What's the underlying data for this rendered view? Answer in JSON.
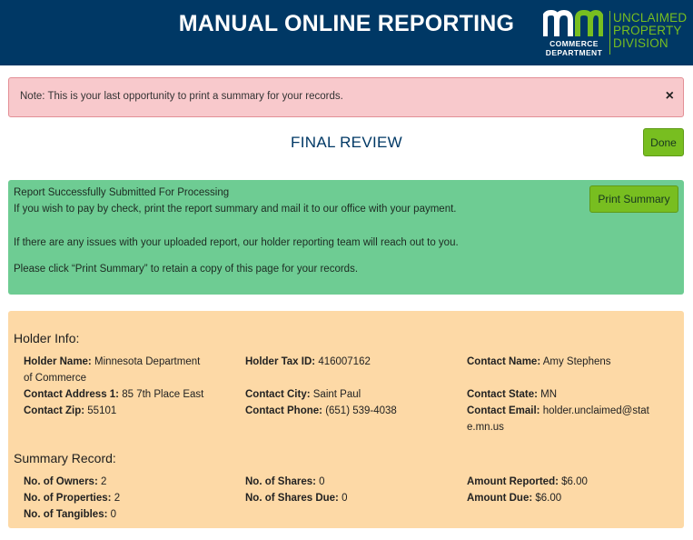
{
  "header": {
    "title": "MANUAL ONLINE REPORTING",
    "logo_top": "COMMERCE",
    "logo_bottom": "DEPARTMENT",
    "division_line1": "UNCLAIMED",
    "division_line2": "PROPERTY",
    "division_line3": "DIVISION",
    "colors": {
      "navy": "#003865",
      "green": "#78be20"
    }
  },
  "alert": {
    "text": "Note: This is your last opportunity to print a summary for your records.",
    "close_label": "×"
  },
  "page": {
    "title": "FINAL REVIEW",
    "done_label": "Done"
  },
  "success": {
    "heading": "Report Successfully Submitted For Processing",
    "line1": "If you wish to pay by check, print the report summary and mail it to our office with your payment.",
    "line2": "If there are any issues with your uploaded report, our holder reporting team will reach out to you.",
    "line3": "Please click “Print Summary” to retain a copy of this page for your records.",
    "print_label": "Print Summary"
  },
  "holder_info": {
    "title": "Holder Info:",
    "holder_name_label": "Holder Name:",
    "holder_name_value_a": "Minnesota Department",
    "holder_name_value_b": "of Commerce",
    "tax_id_label": "Holder Tax ID:",
    "tax_id_value": "416007162",
    "contact_name_label": "Contact Name:",
    "contact_name_value": "Amy Stephens",
    "address_label": "Contact Address 1:",
    "address_value": "85 7th Place East",
    "city_label": "Contact City:",
    "city_value": "Saint Paul",
    "state_label": "Contact State:",
    "state_value": "MN",
    "zip_label": "Contact Zip:",
    "zip_value": "55101",
    "phone_label": "Contact Phone:",
    "phone_value": "(651) 539-4038",
    "email_label": "Contact Email:",
    "email_value_a": "holder.unclaimed@stat",
    "email_value_b": "e.mn.us"
  },
  "summary": {
    "title": "Summary Record:",
    "owners_label": "No. of Owners:",
    "owners_value": "2",
    "properties_label": "No. of Properties:",
    "properties_value": "2",
    "tangibles_label": "No. of Tangibles:",
    "tangibles_value": "0",
    "shares_label": "No. of Shares:",
    "shares_value": "0",
    "shares_due_label": "No. of Shares Due:",
    "shares_due_value": "0",
    "amount_reported_label": "Amount Reported:",
    "amount_reported_value": "$6.00",
    "amount_due_label": "Amount Due:",
    "amount_due_value": "$6.00"
  }
}
